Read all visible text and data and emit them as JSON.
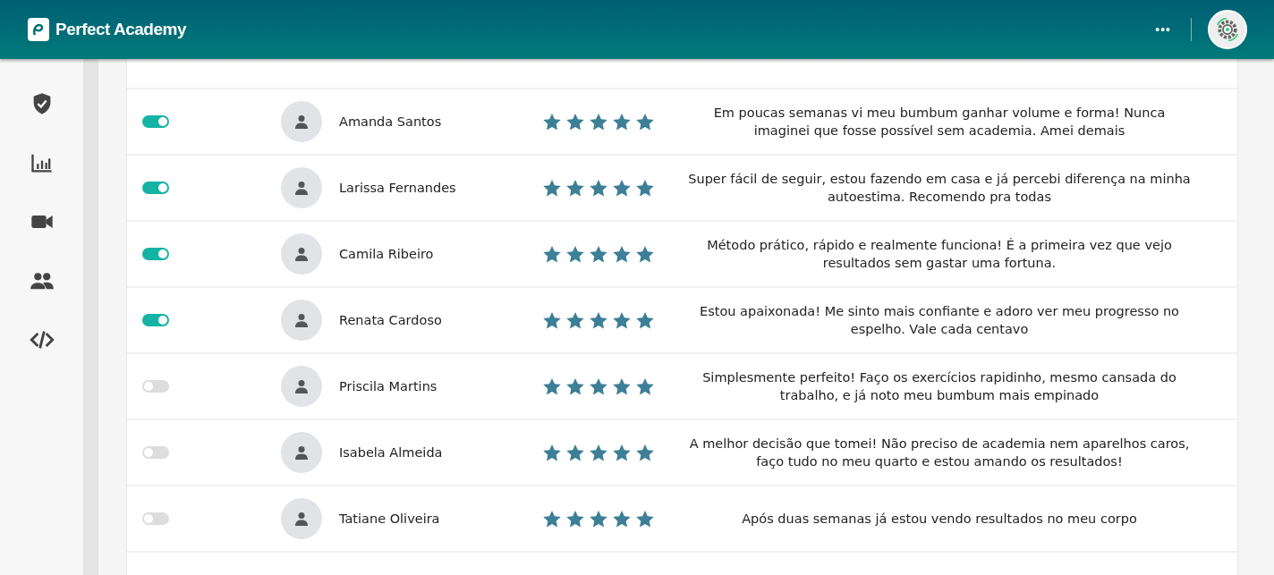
{
  "header": {
    "brand": "Perfect Academy",
    "more_label": "•••"
  },
  "sidebar": {
    "items": [
      {
        "kind": "shield"
      },
      {
        "kind": "chart"
      },
      {
        "kind": "video"
      },
      {
        "kind": "users"
      },
      {
        "kind": "code"
      }
    ]
  },
  "reviews": [
    {
      "on": true,
      "name": "Amanda Santos",
      "stars": 5,
      "comment": "Em poucas semanas vi meu bumbum ganhar volume e forma! Nunca imaginei que fosse possível sem academia. Amei demais"
    },
    {
      "on": true,
      "name": "Larissa Fernandes",
      "stars": 5,
      "comment": "Super fácil de seguir, estou fazendo em casa e já percebi diferença na minha autoestima. Recomendo pra todas"
    },
    {
      "on": true,
      "name": "Camila Ribeiro",
      "stars": 5,
      "comment": "Método prático, rápido e realmente funciona! É a primeira vez que vejo resultados sem gastar uma fortuna."
    },
    {
      "on": true,
      "name": "Renata Cardoso",
      "stars": 5,
      "comment": "Estou apaixonada! Me sinto mais confiante e adoro ver meu progresso no espelho. Vale cada centavo"
    },
    {
      "on": false,
      "name": "Priscila Martins",
      "stars": 5,
      "comment": "Simplesmente perfeito! Faço os exercícios rapidinho, mesmo cansada do trabalho, e já noto meu bumbum mais empinado"
    },
    {
      "on": false,
      "name": "Isabela Almeida",
      "stars": 5,
      "comment": "A melhor decisão que tomei! Não preciso de academia nem aparelhos caros, faço tudo no meu quarto e estou amando os resultados!"
    },
    {
      "on": false,
      "name": "Tatiane Oliveira",
      "stars": 5,
      "comment": "Após duas semanas já estou vendo resultados no meu corpo"
    }
  ]
}
